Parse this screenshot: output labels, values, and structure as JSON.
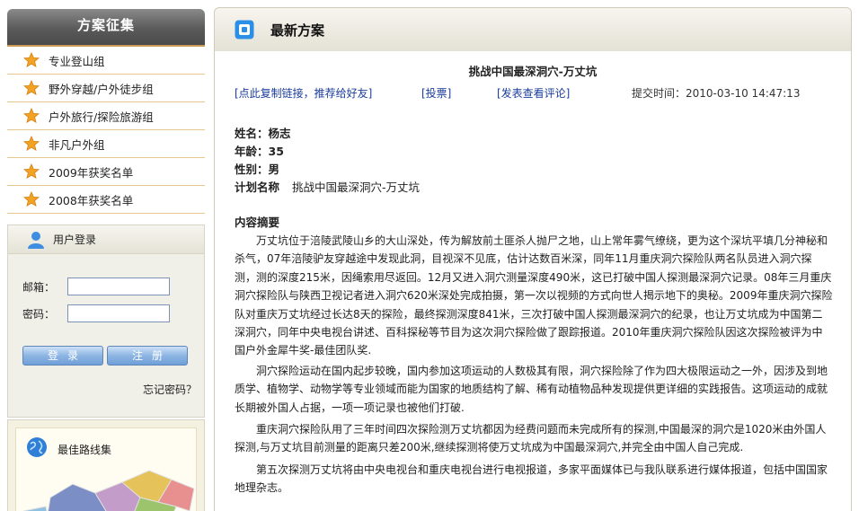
{
  "sidebar": {
    "header": "方案征集",
    "items": [
      {
        "label": "专业登山组"
      },
      {
        "label": "野外穿越/户外徒步组"
      },
      {
        "label": "户外旅行/探险旅游组"
      },
      {
        "label": "非凡户外组"
      },
      {
        "label": "2009年获奖名单"
      },
      {
        "label": "2008年获奖名单"
      }
    ]
  },
  "login": {
    "title": "用户登录",
    "email_label": "邮箱：",
    "password_label": "密码：",
    "login_button": "登录",
    "register_button": "注册",
    "forgot": "忘记密码？"
  },
  "routes": {
    "title": "最佳路线集"
  },
  "main": {
    "title": "最新方案",
    "article_title": "挑战中国最深洞穴-万丈坑",
    "links": {
      "copy": "[点此复制链接，推荐给好友]",
      "vote": "[投票]",
      "comment": "[发表查看评论]"
    },
    "submit_time": "提交时间：2010-03-10 14:47:13",
    "info": {
      "name_label": "姓名：",
      "name": "杨志",
      "age_label": "年龄：",
      "age": "35",
      "gender_label": "性别：",
      "gender": "男",
      "plan_label": "计划名称",
      "plan": "挑战中国最深洞穴-万丈坑"
    },
    "summary_title": "内容摘要",
    "paragraphs": [
      "万丈坑位于涪陵武陵山乡的大山深处，传为解放前土匪杀人抛尸之地，山上常年雾气缭绕，更为这个深坑平填几分神秘和杀气，07年涪陵驴友穿越途中发现此洞，目视深不见底，估计达数百米深，同年11月重庆洞穴探险队两名队员进入洞穴探测，测的深度215米，因绳索用尽返回。12月又进入洞穴测量深度490米，这已打破中国人探测最深洞穴记录。08年三月重庆洞穴探险队与陕西卫视记者进入洞穴620米深处完成拍摄，第一次以视频的方式向世人揭示地下的奥秘。2009年重庆洞穴探险队对重庆万丈坑经过长达8天的探险，最终探测深度841米，三次打破中国人探测最深洞穴的纪录，也让万丈坑成为中国第二深洞穴，同年中央电视台讲述、百科探秘等节目为这次洞穴探险做了跟踪报道。2010年重庆洞穴探险队因这次探险被评为中国户外金犀牛奖-最佳团队奖.",
      "洞穴探险运动在国内起步较晚，国内参加这项运动的人数极其有限，洞穴探险除了作为四大极限运动之一外，因涉及到地质学、植物学、动物学等专业领域而能为国家的地质结构了解、稀有动植物品种发现提供更详细的实践报告。这项运动的成就长期被外国人占据，一项一项记录也被他们打破.",
      "重庆洞穴探险队用了三年时间四次探险测万丈坑都因为经费问题而未完成所有的探测,中国最深的洞穴是1020米由外国人探测,与万丈坑目前测量的距离只差200米,继续探测将使万丈坑成为中国最深洞穴,并完全由中国人自己完成.",
      "第五次探测万丈坑将由中央电视台和重庆电视台进行电视报道，多家平面媒体已与我队联系进行媒体报道，包括中国国家地理杂志。"
    ]
  },
  "colors": {
    "link": "#1a3d9c",
    "star": "#f2a323",
    "sidebar_divider": "#e6c890"
  }
}
